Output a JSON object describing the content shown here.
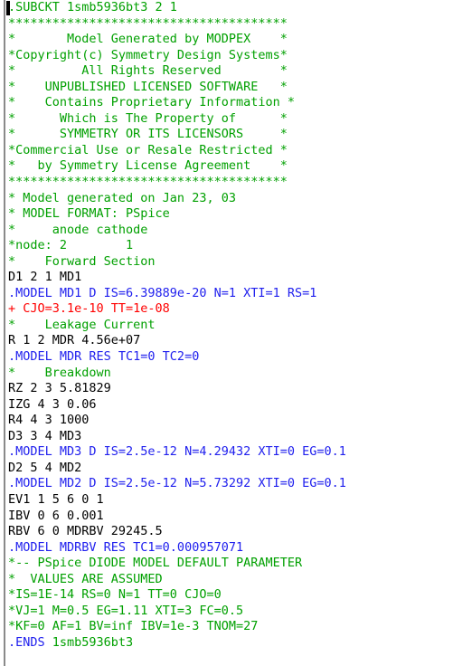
{
  "editor": {
    "title": "PSpice netlist",
    "caret_visible": true,
    "colors": {
      "background": "#ffffff",
      "comment": "#00a000",
      "model_directive": "#2020ee",
      "continuation": "#ff0000",
      "element": "#000000",
      "gutter_rule": "#8a8a8a",
      "caret": "#000000"
    }
  },
  "code": {
    "lines": [
      {
        "kind": "subckt",
        "text": ".SUBCKT 1smb5936bt3 2 1"
      },
      {
        "kind": "comment",
        "text": "**************************************"
      },
      {
        "kind": "comment",
        "text": "*       Model Generated by MODPEX    *"
      },
      {
        "kind": "comment",
        "text": "*Copyright(c) Symmetry Design Systems*"
      },
      {
        "kind": "comment",
        "text": "*         All Rights Reserved        *"
      },
      {
        "kind": "comment",
        "text": "*    UNPUBLISHED LICENSED SOFTWARE   *"
      },
      {
        "kind": "comment",
        "text": "*    Contains Proprietary Information *"
      },
      {
        "kind": "comment",
        "text": "*      Which is The Property of      *"
      },
      {
        "kind": "comment",
        "text": "*      SYMMETRY OR ITS LICENSORS     *"
      },
      {
        "kind": "comment",
        "text": "*Commercial Use or Resale Restricted *"
      },
      {
        "kind": "comment",
        "text": "*   by Symmetry License Agreement    *"
      },
      {
        "kind": "comment",
        "text": "**************************************"
      },
      {
        "kind": "comment",
        "text": "* Model generated on Jan 23, 03"
      },
      {
        "kind": "comment",
        "text": "* MODEL FORMAT: PSpice"
      },
      {
        "kind": "comment",
        "text": "*     anode cathode"
      },
      {
        "kind": "comment",
        "text": "*node: 2        1"
      },
      {
        "kind": "comment",
        "text": "*    Forward Section"
      },
      {
        "kind": "element",
        "text": "D1 2 1 MD1"
      },
      {
        "kind": "model",
        "text": ".MODEL MD1 D IS=6.39889e-20 N=1 XTI=1 RS=1"
      },
      {
        "kind": "cont",
        "text": "+ CJO=3.1e-10 TT=1e-08"
      },
      {
        "kind": "comment",
        "text": "*    Leakage Current"
      },
      {
        "kind": "element",
        "text": "R 1 2 MDR 4.56e+07"
      },
      {
        "kind": "model",
        "text": ".MODEL MDR RES TC1=0 TC2=0"
      },
      {
        "kind": "comment",
        "text": "*    Breakdown"
      },
      {
        "kind": "element",
        "text": "RZ 2 3 5.81829"
      },
      {
        "kind": "element",
        "text": "IZG 4 3 0.06"
      },
      {
        "kind": "element",
        "text": "R4 4 3 1000"
      },
      {
        "kind": "element",
        "text": "D3 3 4 MD3"
      },
      {
        "kind": "model",
        "text": ".MODEL MD3 D IS=2.5e-12 N=4.29432 XTI=0 EG=0.1"
      },
      {
        "kind": "element",
        "text": "D2 5 4 MD2"
      },
      {
        "kind": "model",
        "text": ".MODEL MD2 D IS=2.5e-12 N=5.73292 XTI=0 EG=0.1"
      },
      {
        "kind": "element",
        "text": "EV1 1 5 6 0 1"
      },
      {
        "kind": "element",
        "text": "IBV 0 6 0.001"
      },
      {
        "kind": "element",
        "text": "RBV 6 0 MDRBV 29245.5"
      },
      {
        "kind": "model",
        "text": ".MODEL MDRBV RES TC1=0.000957071"
      },
      {
        "kind": "comment",
        "text": "*-- PSpice DIODE MODEL DEFAULT PARAMETER"
      },
      {
        "kind": "comment",
        "text": "*  VALUES ARE ASSUMED"
      },
      {
        "kind": "comment",
        "text": "*IS=1E-14 RS=0 N=1 TT=0 CJO=0"
      },
      {
        "kind": "comment",
        "text": "*VJ=1 M=0.5 EG=1.11 XTI=3 FC=0.5"
      },
      {
        "kind": "comment",
        "text": "*KF=0 AF=1 BV=inf IBV=1e-3 TNOM=27"
      },
      {
        "kind": "ends",
        "text": ".ENDS 1smb5936bt3",
        "prefix": ".ENDS",
        "suffix": " 1smb5936bt3"
      }
    ]
  }
}
